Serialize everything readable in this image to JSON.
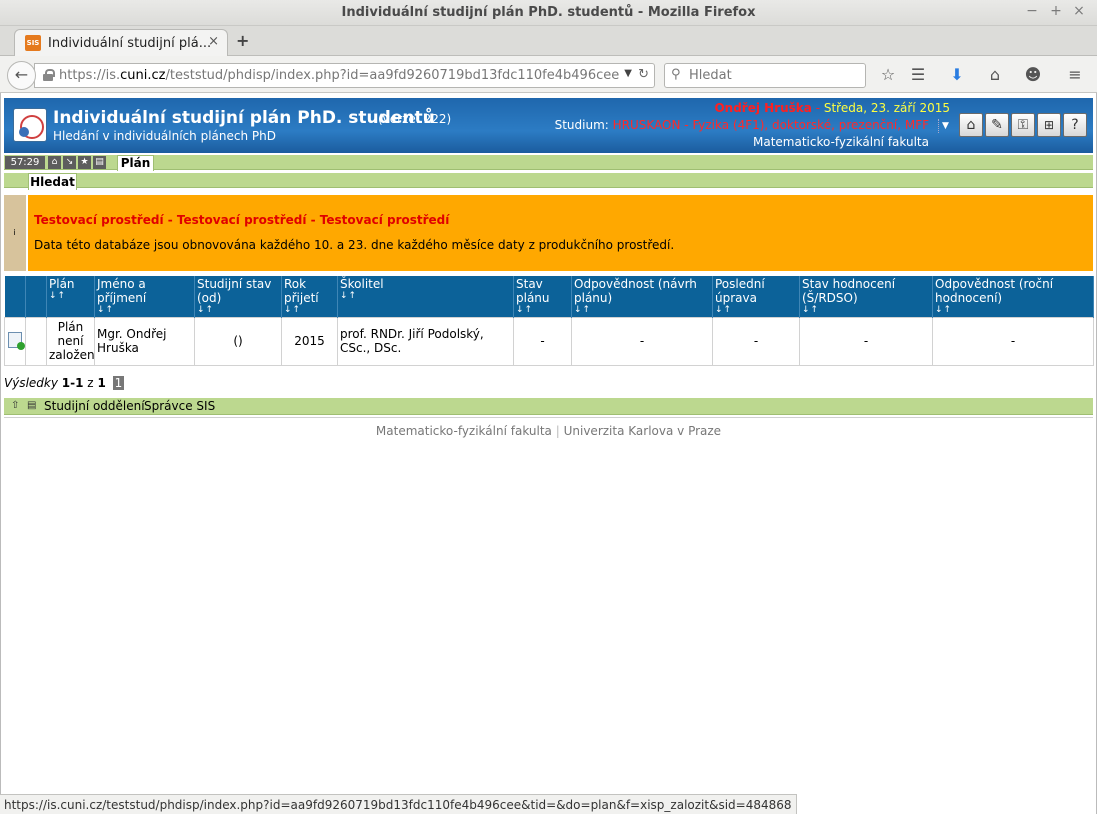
{
  "window": {
    "title": "Individuální studijní plán PhD. studentů - Mozilla Firefox",
    "controls": {
      "minimize": "−",
      "maximize": "+",
      "close": "×"
    }
  },
  "browser": {
    "tab_label": "Individuální studijní plá...",
    "tab_favicon_text": "SIS",
    "tab_close": "×",
    "new_tab": "+",
    "url_prefix": "https://is.",
    "url_domain": "cuni.cz",
    "url_rest": "/teststud/phdisp/index.php?id=aa9fd9260719bd13fdc110fe4b496cee&tid=",
    "search_placeholder": "Hledat",
    "status_url": "https://is.cuni.cz/teststud/phdisp/index.php?id=aa9fd9260719bd13fdc110fe4b496cee&tid=&do=plan&f=xisp_zalozit&sid=484868"
  },
  "header": {
    "app_title": "Individuální studijní plán PhD. studentů",
    "version": "(verze: 222)",
    "subtitle": "Hledání v individuálních plánech PhD",
    "user_name": "Ondřej Hruška",
    "user_sep": " - ",
    "date": "Středa, 23. září 2015",
    "study_label": "Studium:",
    "study_value": "HRUSKAON - Fyzika (4F1), doktorské, prezenční, MFF",
    "faculty": "Matematicko-fyzikální fakulta"
  },
  "menu": {
    "timer": "57:29",
    "tab_plan": "Plán",
    "tab_search": "Hledat"
  },
  "notice": {
    "title": "Testovací prostředí - Testovací prostředí - Testovací prostředí",
    "text": "Data této databáze jsou obnovována každého 10. a 23. dne každého měsíce daty z produkčního prostředí.",
    "info_glyph": "i"
  },
  "table": {
    "sort_arrows": "↓↑",
    "columns": [
      "Plán",
      "Jméno a příjmení",
      "Studijní stav (od)",
      "Rok přijetí",
      "Školitel",
      "Stav plánu",
      "Odpovědnost (návrh plánu)",
      "Poslední úprava",
      "Stav hodnocení (Š/RDSO)",
      "Odpovědnost (roční hodnocení)"
    ],
    "row": {
      "plan": "Plán není založen",
      "name": "Mgr. Ondřej Hruška",
      "status": "()",
      "year": "2015",
      "supervisor": "prof. RNDr. Jiří Podolský, CSc., DSc.",
      "plan_status": "-",
      "responsibility_plan": "-",
      "last_edit": "-",
      "evaluation_status": "-",
      "responsibility_eval": "-"
    }
  },
  "results": {
    "label": "Výsledky",
    "range": "1-1",
    "of": "z",
    "total": "1",
    "page": "1"
  },
  "footer": {
    "dept": "Studijní oddělení",
    "admin": "Správce SIS",
    "faculty": "Matematicko-fyzikální fakulta",
    "sep": "|",
    "university": "Univerzita Karlova v Praze"
  }
}
